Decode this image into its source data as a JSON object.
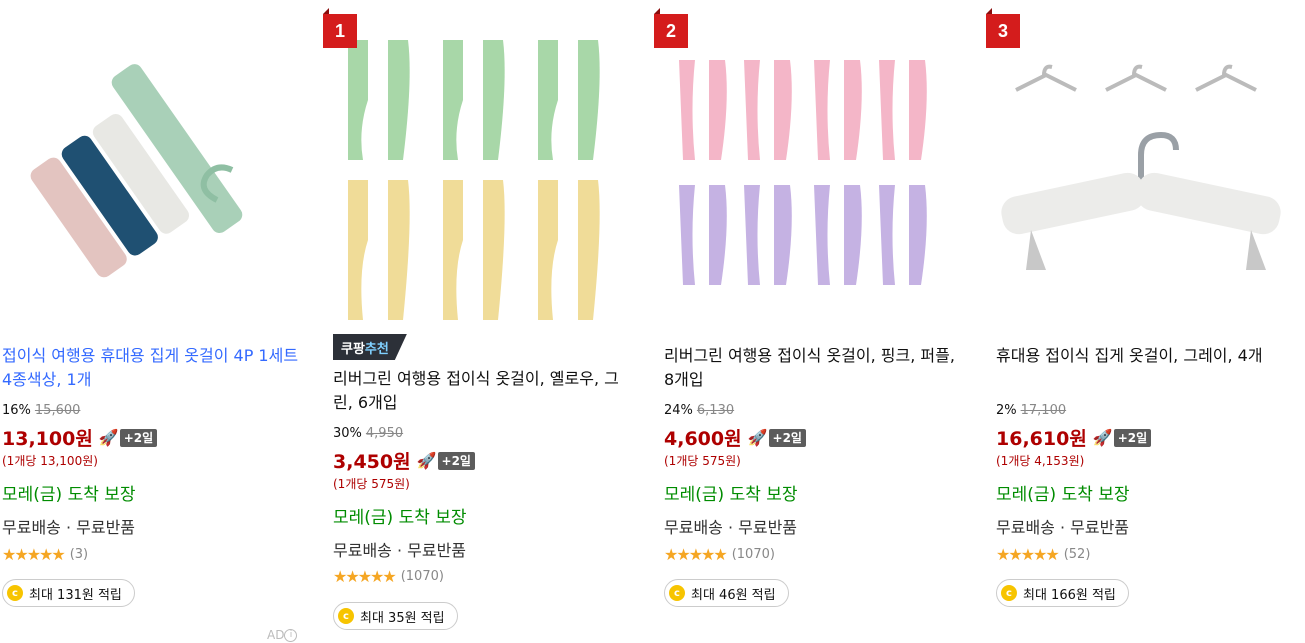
{
  "colors": {
    "price": "#ae0000",
    "delivery": "#008c00",
    "ad_title": "#346aff",
    "rank_badge": "#d41c1c",
    "star": "#f5a623"
  },
  "ad_label": "AD",
  "products": [
    {
      "title": "접이식 여행용 휴대용 집게 옷걸이 4P 1세트 4종색상, 1개",
      "is_ad": true,
      "discount": "16%",
      "original_price": "15,600",
      "price": "13,100원",
      "rocket_icon": "rocket-icon",
      "delivery_badge": "+2일",
      "unit_price": "(1개당 13,100원)",
      "arrival": "모레(금) 도착 보장",
      "shipping": "무료배송 · 무료반품",
      "rating": 4.5,
      "review_count": "(3)",
      "cashback": "최대 131원 적립"
    },
    {
      "rank": "1",
      "badge_prefix": "쿠팡",
      "badge_suffix": "추천",
      "title": "리버그린 여행용 접이식 옷걸이, 옐로우, 그린, 6개입",
      "is_ad": false,
      "discount": "30%",
      "original_price": "4,950",
      "price": "3,450원",
      "rocket_icon": "rocket-icon",
      "delivery_badge": "+2일",
      "unit_price": "(1개당 575원)",
      "arrival": "모레(금) 도착 보장",
      "shipping": "무료배송 · 무료반품",
      "rating": 4.5,
      "review_count": "(1070)",
      "cashback": "최대 35원 적립"
    },
    {
      "rank": "2",
      "title": "리버그린 여행용 접이식 옷걸이, 핑크, 퍼플, 8개입",
      "is_ad": false,
      "discount": "24%",
      "original_price": "6,130",
      "price": "4,600원",
      "rocket_icon": "rocket-icon",
      "delivery_badge": "+2일",
      "unit_price": "(1개당 575원)",
      "arrival": "모레(금) 도착 보장",
      "shipping": "무료배송 · 무료반품",
      "rating": 4.5,
      "review_count": "(1070)",
      "cashback": "최대 46원 적립"
    },
    {
      "rank": "3",
      "title": "휴대용 접이식 집게 옷걸이, 그레이, 4개",
      "is_ad": false,
      "discount": "2%",
      "original_price": "17,100",
      "price": "16,610원",
      "rocket_icon": "rocket-icon",
      "delivery_badge": "+2일",
      "unit_price": "(1개당 4,153원)",
      "arrival": "모레(금) 도착 보장",
      "shipping": "무료배송 · 무료반품",
      "rating": 4.5,
      "review_count": "(52)",
      "cashback": "최대 166원 적립"
    }
  ]
}
